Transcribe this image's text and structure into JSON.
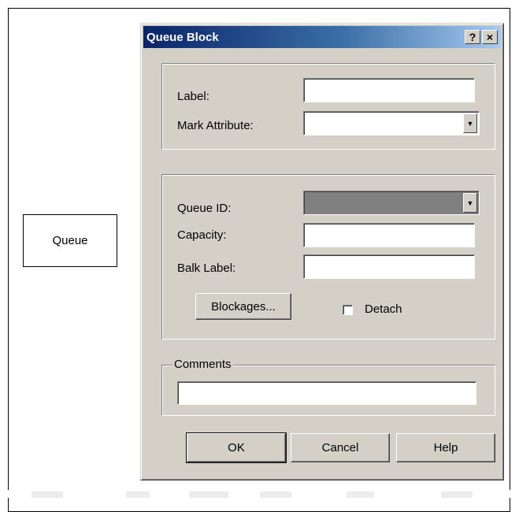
{
  "canvas": {
    "block_label": "Queue"
  },
  "dialog": {
    "title": "Queue Block",
    "help_symbol": "?",
    "close_symbol": "×",
    "general": {
      "label_label": "Label:",
      "label_value": "",
      "mark_attribute_label": "Mark Attribute:",
      "mark_attribute_value": ""
    },
    "queue": {
      "queue_id_label": "Queue ID:",
      "queue_id_value": "",
      "capacity_label": "Capacity:",
      "capacity_value": "",
      "balk_label_label": "Balk Label:",
      "balk_label_value": "",
      "blockages_button": "Blockages...",
      "detach_label": "Detach",
      "detach_checked": false
    },
    "comments": {
      "legend": "Comments",
      "value": ""
    },
    "buttons": {
      "ok": "OK",
      "cancel": "Cancel",
      "help": "Help"
    }
  }
}
